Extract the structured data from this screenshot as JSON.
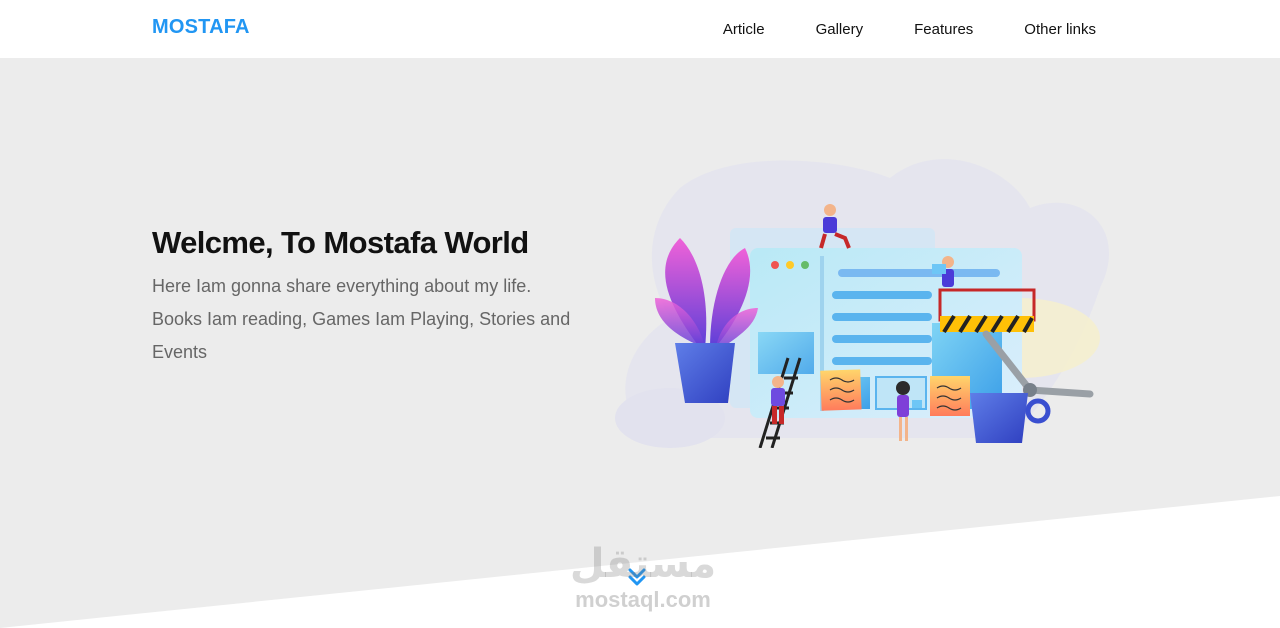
{
  "brand": {
    "logo": "MOSTAFA",
    "accent_color": "#2196f3"
  },
  "nav": {
    "links": [
      "Article",
      "Gallery",
      "Features",
      "Other links"
    ]
  },
  "hero": {
    "title": "Welcme, To Mostafa World",
    "description_line1": "Here Iam gonna share everything about my life.",
    "description_line2": "Books Iam reading, Games Iam Playing, Stories and",
    "description_line3": "Events",
    "illustration": "website-construction-illustration",
    "scroll_icon": "double-chevron-down-icon"
  },
  "watermark": {
    "arabic": "مستقل",
    "latin": "mostaql.com"
  }
}
